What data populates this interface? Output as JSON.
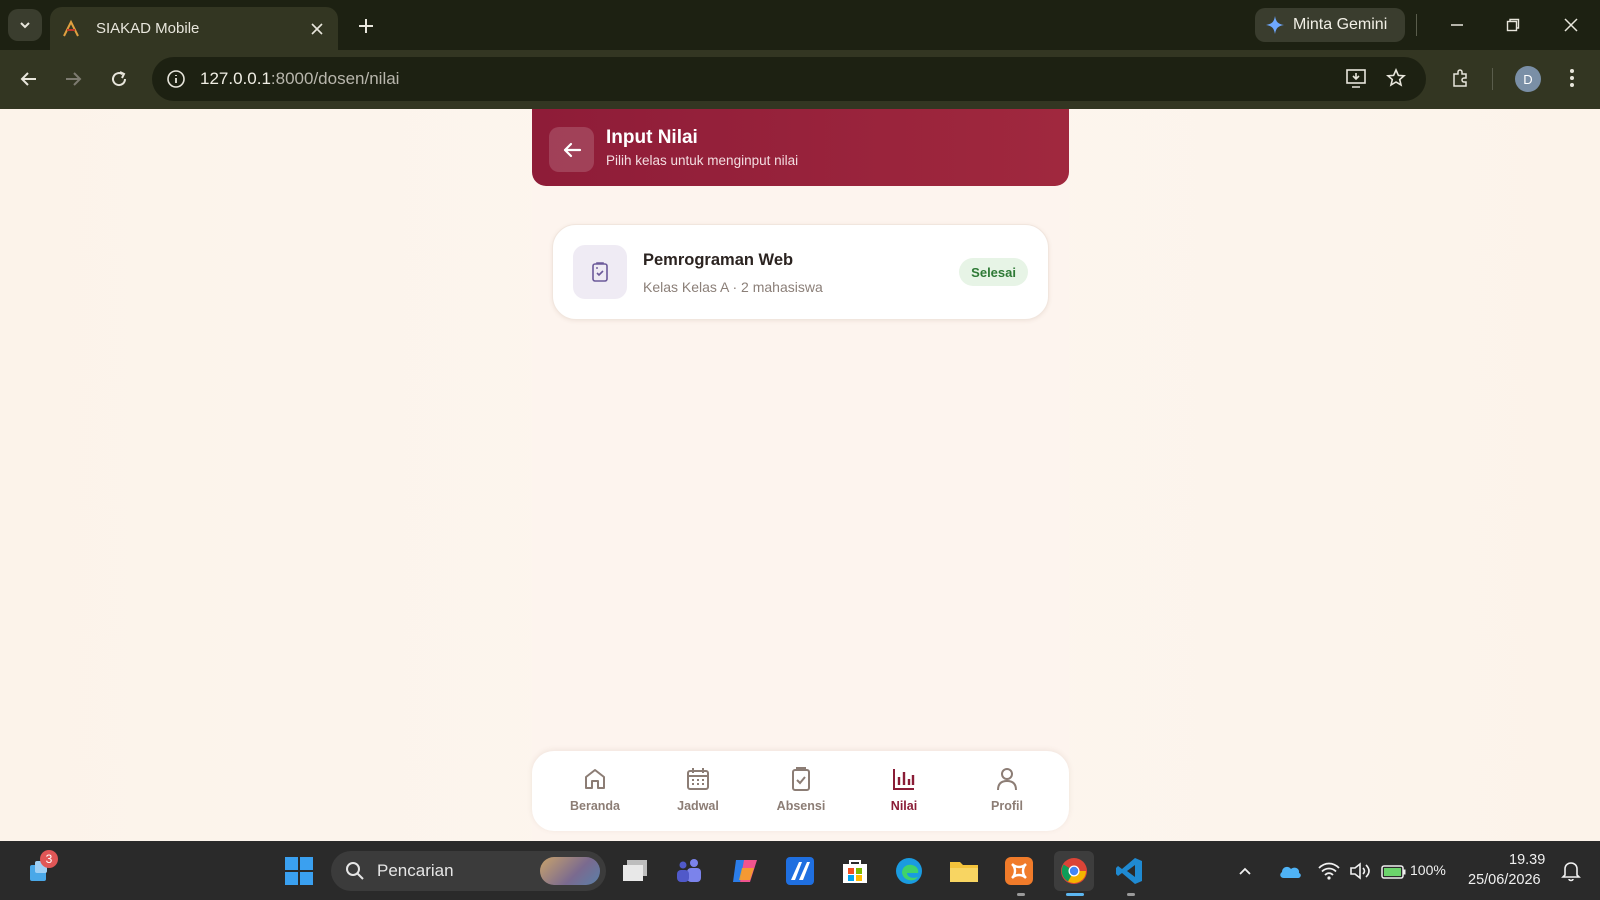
{
  "browser": {
    "tab_title": "SIAKAD Mobile",
    "gemini_label": "Minta Gemini",
    "url_host": "127.0.0.1",
    "url_path": ":8000/dosen/nilai",
    "profile_initial": "D"
  },
  "header": {
    "title": "Input Nilai",
    "subtitle": "Pilih kelas untuk menginput nilai"
  },
  "classes": [
    {
      "name": "Pemrograman Web",
      "detail": "Kelas Kelas A · 2 mahasiswa",
      "status": "Selesai",
      "icon": "clipboard-check-icon"
    }
  ],
  "bottom_nav": {
    "items": [
      {
        "label": "Beranda",
        "icon": "home-icon"
      },
      {
        "label": "Jadwal",
        "icon": "calendar-icon"
      },
      {
        "label": "Absensi",
        "icon": "clipboard-check-icon"
      },
      {
        "label": "Nilai",
        "icon": "bar-chart-icon",
        "active": true
      },
      {
        "label": "Profil",
        "icon": "user-icon"
      }
    ]
  },
  "taskbar": {
    "notification_count": "3",
    "search_placeholder": "Pencarian",
    "battery": "100%",
    "time": "19.39",
    "date": "25/06/2026"
  },
  "colors": {
    "brand": "#8e1c38",
    "badge_bg": "#e7f4e6",
    "badge_text": "#2f7a36"
  }
}
